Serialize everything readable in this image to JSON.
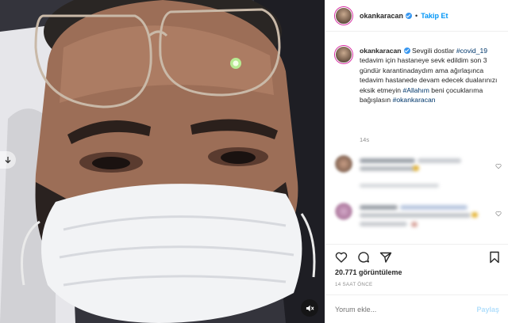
{
  "post": {
    "username": "okankaracan",
    "follow_label": "Takip Et",
    "separator": "•",
    "caption": {
      "username": "okankaracan",
      "text_1": " Sevgili dostlar ",
      "tag_1": "#covid_19",
      "text_2": " tedavim için hastaneye sevk edildim son 3 gündür karantinadaydım ama ağırlaşınca tedavim hastanede devam edecek dualarınızı eksik etmeyin ",
      "tag_2": "#Allahım",
      "text_3": " beni çocuklarıma bağışlasın ",
      "tag_3": "#okankaracan"
    },
    "caption_time": "14s",
    "views": "20.771 görüntüleme",
    "time_ago": "14 SAAT ÖNCE",
    "comment_placeholder": "Yorum ekle...",
    "post_label": "Paylaş"
  },
  "icons": {
    "verified": "verified-badge-icon",
    "like": "heart-icon",
    "comment": "comment-icon",
    "share": "paper-plane-icon",
    "save": "bookmark-icon",
    "mute": "speaker-muted-icon",
    "prev": "arrow-down-icon"
  },
  "colors": {
    "accent": "#0095f6",
    "tag": "#00376b",
    "muted": "#8e8e8e",
    "post_disabled": "#b2dffc"
  }
}
